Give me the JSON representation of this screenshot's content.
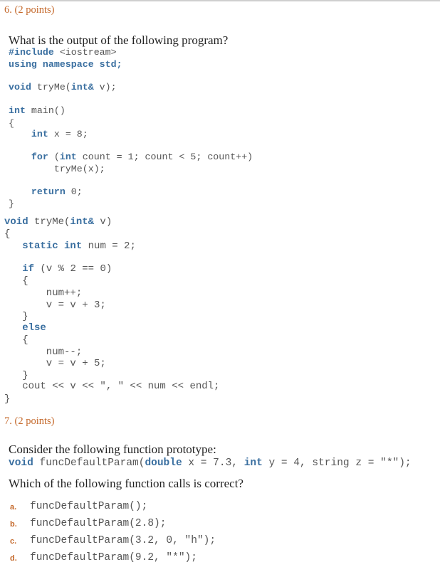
{
  "q6": {
    "header": "6. (2 points)",
    "prompt": "What is the output of the following program?",
    "code": [
      {
        "parts": [
          {
            "t": "#include",
            "kw": true
          },
          {
            "t": " <iostream>"
          }
        ]
      },
      {
        "parts": [
          {
            "t": "using namespace std;",
            "kw": true
          }
        ]
      },
      {
        "parts": [
          {
            "t": "void",
            "kw": true
          },
          {
            "t": " tryMe("
          },
          {
            "t": "int&",
            "kw": true
          },
          {
            "t": " v);"
          }
        ]
      },
      {
        "parts": [
          {
            "t": "int",
            "kw": true
          },
          {
            "t": " main()"
          }
        ]
      },
      {
        "parts": [
          {
            "t": "{"
          }
        ]
      },
      {
        "parts": [
          {
            "t": "    "
          },
          {
            "t": "int",
            "kw": true
          },
          {
            "t": " x = 8;"
          }
        ]
      },
      {
        "parts": [
          {
            "t": "    "
          },
          {
            "t": "for",
            "kw": true
          },
          {
            "t": " ("
          },
          {
            "t": "int",
            "kw": true
          },
          {
            "t": " count = 1; count < 5; count++)"
          }
        ]
      },
      {
        "parts": [
          {
            "t": "        tryMe(x);"
          }
        ]
      },
      {
        "parts": [
          {
            "t": "    "
          },
          {
            "t": "return",
            "kw": true
          },
          {
            "t": " 0;"
          }
        ]
      },
      {
        "parts": [
          {
            "t": "}"
          }
        ]
      },
      {
        "parts": [
          {
            "t": "void",
            "kw": true
          },
          {
            "t": " tryMe("
          },
          {
            "t": "int&",
            "kw": true
          },
          {
            "t": " v)"
          }
        ]
      },
      {
        "parts": [
          {
            "t": "{"
          }
        ]
      },
      {
        "parts": [
          {
            "t": "   "
          },
          {
            "t": "static int",
            "kw": true
          },
          {
            "t": " num = 2;"
          }
        ]
      },
      {
        "parts": [
          {
            "t": "   "
          },
          {
            "t": "if",
            "kw": true
          },
          {
            "t": " (v % 2 == 0)"
          }
        ]
      },
      {
        "parts": [
          {
            "t": "   {"
          }
        ]
      },
      {
        "parts": [
          {
            "t": "       num++;"
          }
        ]
      },
      {
        "parts": [
          {
            "t": "       v = v + 3;"
          }
        ]
      },
      {
        "parts": [
          {
            "t": "   }"
          }
        ]
      },
      {
        "parts": [
          {
            "t": "   "
          },
          {
            "t": "else",
            "kw": true
          }
        ]
      },
      {
        "parts": [
          {
            "t": "   {"
          }
        ]
      },
      {
        "parts": [
          {
            "t": "       num--;"
          }
        ]
      },
      {
        "parts": [
          {
            "t": "       v = v + 5;"
          }
        ]
      },
      {
        "parts": [
          {
            "t": "   }"
          }
        ]
      },
      {
        "parts": [
          {
            "t": "   cout << v << \", \" << num << endl;"
          }
        ]
      },
      {
        "parts": [
          {
            "t": "}"
          }
        ]
      }
    ]
  },
  "q7": {
    "header": "7. (2 points)",
    "prompt": "Consider the following function prototype:",
    "prototype": [
      {
        "t": "void",
        "kw": true
      },
      {
        "t": " funcDefaultParam("
      },
      {
        "t": "double",
        "kw": true
      },
      {
        "t": " x = 7.3, "
      },
      {
        "t": "int",
        "kw": true
      },
      {
        "t": " y = 4, string z = \"*\");"
      }
    ],
    "question": "Which of the following function calls is correct?",
    "options": [
      {
        "letter": "a.",
        "code": "funcDefaultParam();"
      },
      {
        "letter": "b.",
        "code": "funcDefaultParam(2.8);"
      },
      {
        "letter": "c.",
        "code": "funcDefaultParam(3.2, 0, \"h\");"
      },
      {
        "letter": "d.",
        "code": "funcDefaultParam(9.2, \"*\");"
      }
    ]
  }
}
